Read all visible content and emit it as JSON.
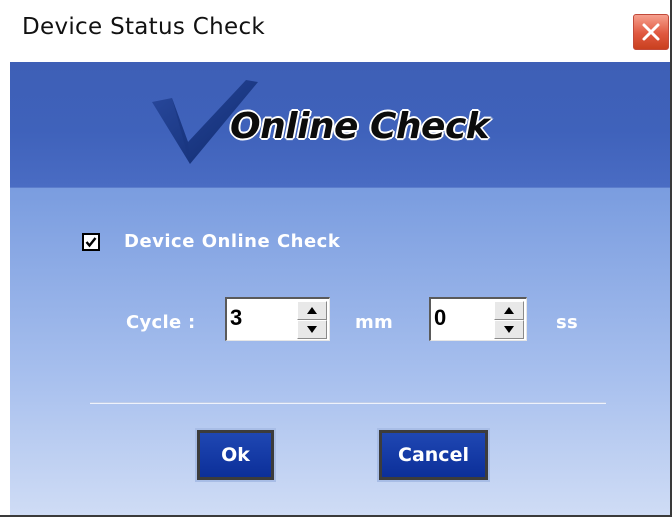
{
  "window": {
    "title": "Device Status Check"
  },
  "banner": {
    "title": "Online Check"
  },
  "online_check": {
    "label": "Device Online Check",
    "checked": true
  },
  "cycle": {
    "label": "Cycle :",
    "minutes_value": "3",
    "minutes_unit": "mm",
    "seconds_value": "0",
    "seconds_unit": "ss"
  },
  "buttons": {
    "ok_label": "Ok",
    "cancel_label": "Cancel"
  },
  "colors": {
    "banner": "#3f62bb",
    "button": "#1a3fa8",
    "close": "#e0583f"
  },
  "icons": {
    "logo": "checkmark-logo-icon",
    "close": "close-icon",
    "up": "spin-up-arrow-icon",
    "down": "spin-down-arrow-icon"
  }
}
